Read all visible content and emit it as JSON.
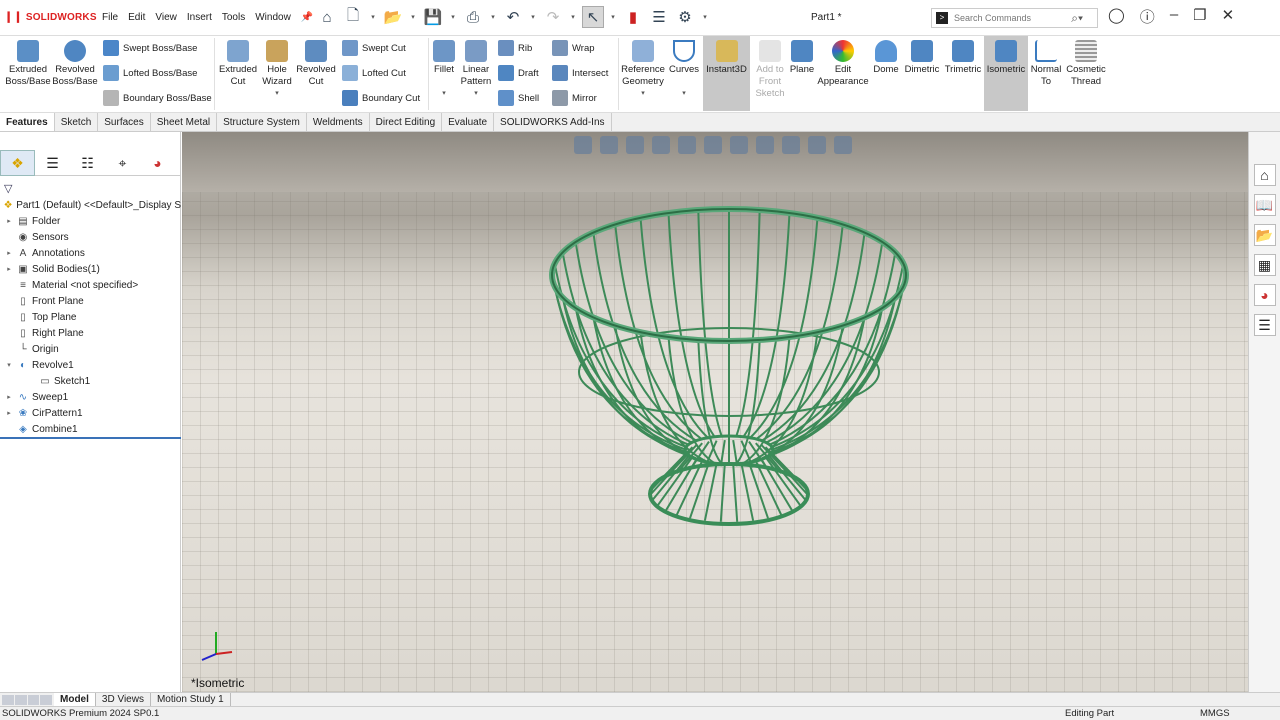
{
  "app": {
    "logo": "SOLIDWORKS",
    "doc_title": "Part1 *"
  },
  "menu": [
    "File",
    "Edit",
    "View",
    "Insert",
    "Tools",
    "Window"
  ],
  "search": {
    "placeholder": "Search Commands"
  },
  "ribbon": {
    "extruded_boss": "Extruded Boss/Base",
    "revolved_boss": "Revolved Boss/Base",
    "swept_boss": "Swept Boss/Base",
    "lofted_boss": "Lofted Boss/Base",
    "boundary_boss": "Boundary Boss/Base",
    "extruded_cut": "Extruded Cut",
    "hole_wizard": "Hole Wizard",
    "revolved_cut": "Revolved Cut",
    "swept_cut": "Swept Cut",
    "lofted_cut": "Lofted Cut",
    "boundary_cut": "Boundary Cut",
    "fillet": "Fillet",
    "linear_pattern": "Linear Pattern",
    "rib": "Rib",
    "draft": "Draft",
    "shell": "Shell",
    "wrap": "Wrap",
    "intersect": "Intersect",
    "mirror": "Mirror",
    "reference_geometry": "Reference Geometry",
    "curves": "Curves",
    "instant3d": "Instant3D",
    "add_to_front": "Add to Front Sketch",
    "plane": "Plane",
    "edit_appearance": "Edit Appearance",
    "dome": "Dome",
    "dimetric": "Dimetric",
    "trimetric": "Trimetric",
    "isometric": "Isometric",
    "normal_to": "Normal To",
    "cosmetic_thread": "Cosmetic Thread"
  },
  "tabs": [
    "Features",
    "Sketch",
    "Surfaces",
    "Sheet Metal",
    "Structure System",
    "Weldments",
    "Direct Editing",
    "Evaluate",
    "SOLIDWORKS Add-Ins"
  ],
  "tree": [
    {
      "label": "Part1 (Default) <<Default>_Display S",
      "arrow": "",
      "icon": "part-icon"
    },
    {
      "label": "Folder",
      "arrow": "▸",
      "icon": "folder-icon"
    },
    {
      "label": "Sensors",
      "arrow": "",
      "icon": "sensor-icon"
    },
    {
      "label": "Annotations",
      "arrow": "▸",
      "icon": "annotation-icon"
    },
    {
      "label": "Solid Bodies(1)",
      "arrow": "▸",
      "icon": "solid-bodies-icon"
    },
    {
      "label": "Material <not specified>",
      "arrow": "",
      "icon": "material-icon"
    },
    {
      "label": "Front Plane",
      "arrow": "",
      "icon": "plane-icon"
    },
    {
      "label": "Top Plane",
      "arrow": "",
      "icon": "plane-icon"
    },
    {
      "label": "Right Plane",
      "arrow": "",
      "icon": "plane-icon"
    },
    {
      "label": "Origin",
      "arrow": "",
      "icon": "origin-icon"
    },
    {
      "label": "Revolve1",
      "arrow": "▾",
      "icon": "revolve-icon"
    },
    {
      "label": "Sketch1",
      "arrow": "",
      "icon": "sketch-icon"
    },
    {
      "label": "Sweep1",
      "arrow": "▸",
      "icon": "sweep-icon"
    },
    {
      "label": "CirPattern1",
      "arrow": "▸",
      "icon": "circular-pattern-icon"
    },
    {
      "label": "Combine1",
      "arrow": "",
      "icon": "combine-icon"
    }
  ],
  "viewport": {
    "view_label": "*Isometric"
  },
  "bottom_tabs": [
    "Model",
    "3D Views",
    "Motion Study 1"
  ],
  "status": {
    "app": "SOLIDWORKS Premium 2024 SP0.1",
    "mode": "Editing Part",
    "units": "MMGS"
  }
}
